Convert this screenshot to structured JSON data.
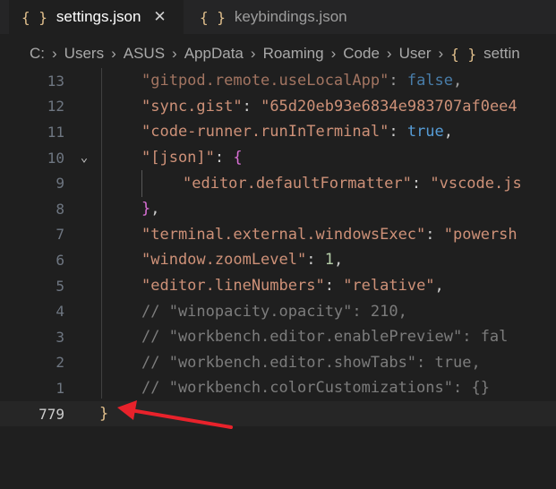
{
  "tabs": [
    {
      "label": "settings.json",
      "icon": "json-braces-icon",
      "braces": "{ }",
      "close": "✕"
    },
    {
      "label": "keybindings.json",
      "icon": "json-braces-icon",
      "braces": "{ }"
    }
  ],
  "breadcrumb": {
    "items": [
      "C:",
      "Users",
      "ASUS",
      "AppData",
      "Roaming",
      "Code",
      "User"
    ],
    "separator": "›",
    "file_braces": "{ }",
    "file_label": "settin"
  },
  "editor": {
    "lines": [
      {
        "num": "13",
        "key": "\"gitpod.remote.useLocalApp\"",
        "colon": ": ",
        "value": "false",
        "value_type": "keyword",
        "tail": ","
      },
      {
        "num": "12",
        "key": "\"sync.gist\"",
        "colon": ": ",
        "value": "\"65d20eb93e6834e983707af0ee4",
        "value_type": "string",
        "tail": ""
      },
      {
        "num": "11",
        "key": "\"code-runner.runInTerminal\"",
        "colon": ": ",
        "value": "true",
        "value_type": "keyword",
        "tail": ","
      },
      {
        "num": "10",
        "key": "\"[json]\"",
        "colon": ": ",
        "value": "{",
        "value_type": "brace",
        "tail": "",
        "fold": "⌄"
      },
      {
        "num": "9",
        "key": "\"editor.defaultFormatter\"",
        "colon": ": ",
        "value": "\"vscode.js",
        "value_type": "string",
        "tail": ""
      },
      {
        "num": "8",
        "key": "",
        "colon": "",
        "value": "}",
        "value_type": "brace",
        "tail": ","
      },
      {
        "num": "7",
        "key": "\"terminal.external.windowsExec\"",
        "colon": ": ",
        "value": "\"powersh",
        "value_type": "string",
        "tail": ""
      },
      {
        "num": "6",
        "key": "\"window.zoomLevel\"",
        "colon": ": ",
        "value": "1",
        "value_type": "number",
        "tail": ","
      },
      {
        "num": "5",
        "key": "\"editor.lineNumbers\"",
        "colon": ": ",
        "value": "\"relative\"",
        "value_type": "string",
        "tail": ","
      },
      {
        "num": "4",
        "comment": "// \"winopacity.opacity\": 210,"
      },
      {
        "num": "3",
        "comment": "// \"workbench.editor.enablePreview\": fal"
      },
      {
        "num": "2",
        "comment": "// \"workbench.editor.showTabs\": true,"
      },
      {
        "num": "1",
        "comment": "// \"workbench.colorCustomizations\": {}"
      },
      {
        "num": "779",
        "closing": "}"
      }
    ]
  },
  "colors": {
    "background": "#1f1f1f",
    "string": "#ce9178",
    "keyword": "#569cd6",
    "number": "#b5cea8",
    "comment": "#6a9955",
    "bracket_gold": "#e2c08d",
    "bracket_purple": "#da70d6",
    "annotation_arrow": "#e8222b"
  }
}
